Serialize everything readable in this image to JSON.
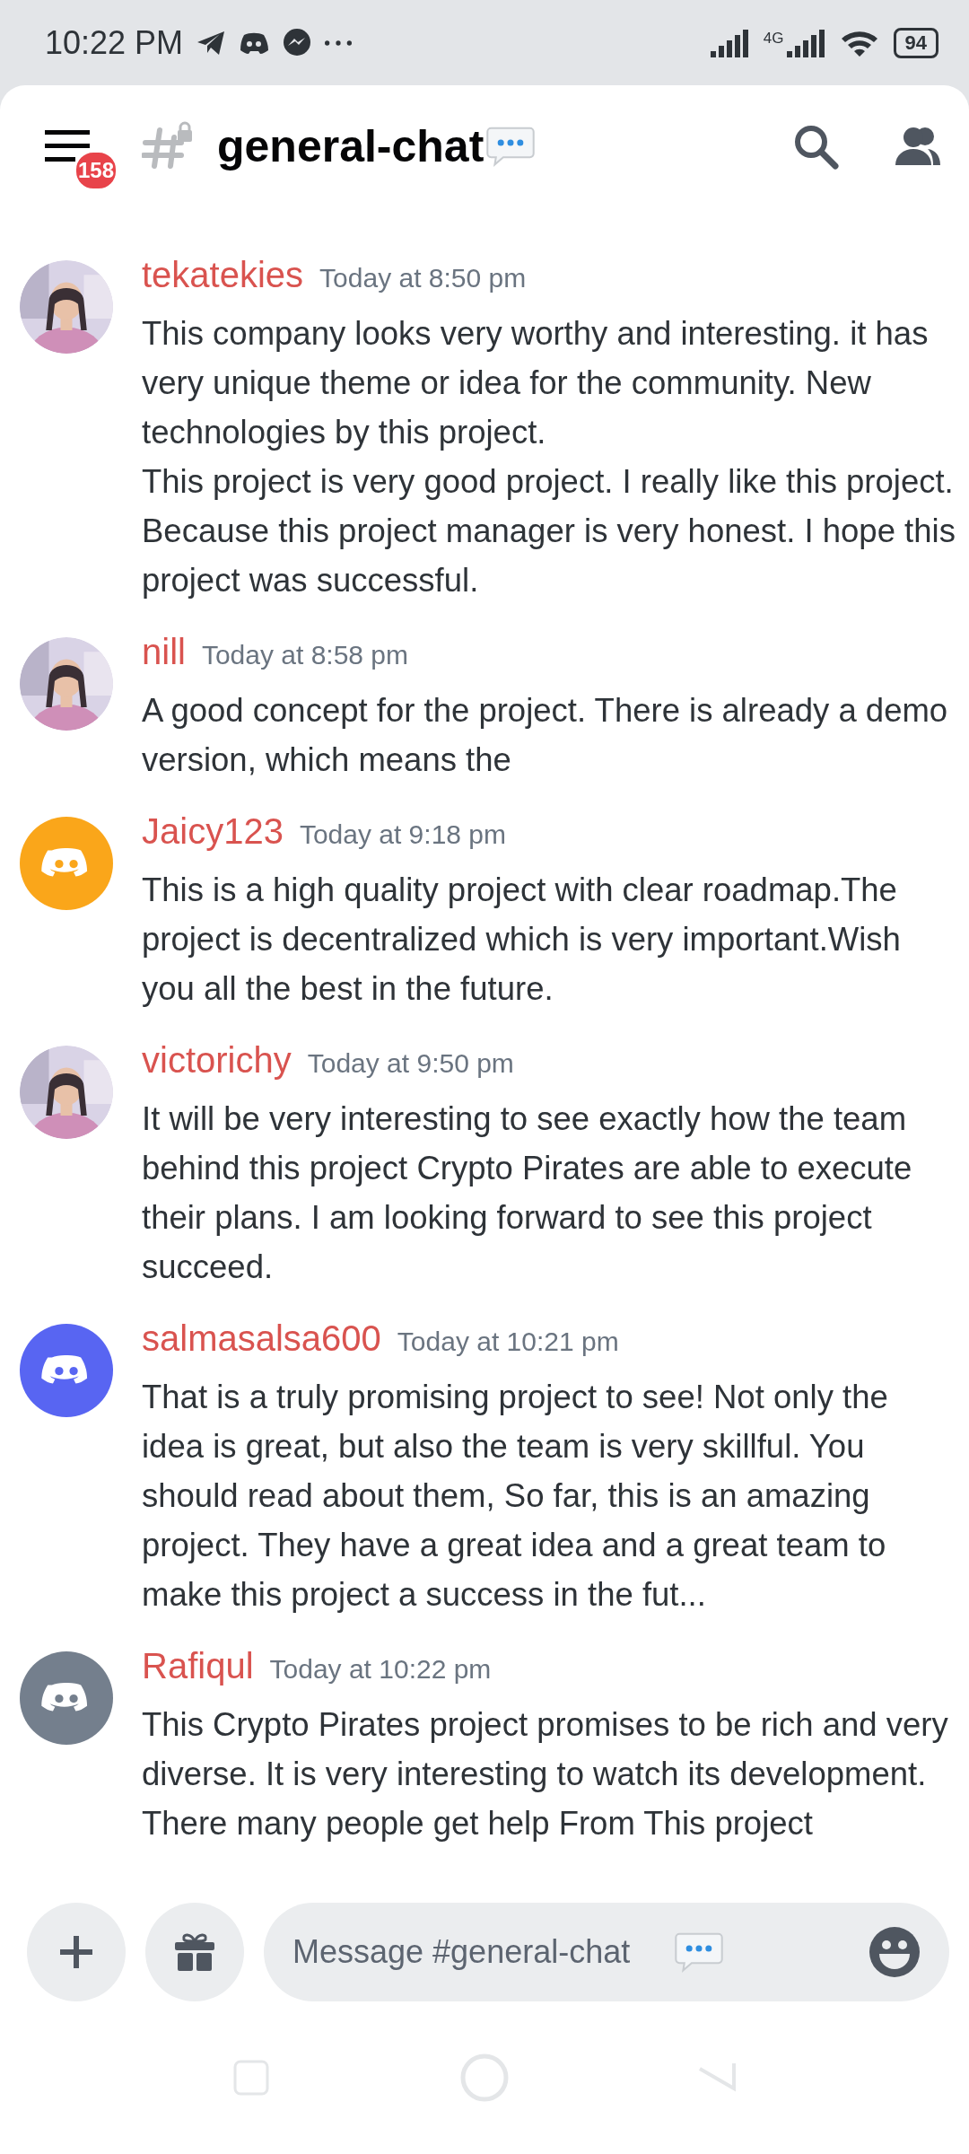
{
  "status_bar": {
    "time": "10:22 PM",
    "network": "4G",
    "battery": "94"
  },
  "header": {
    "badge": "158",
    "channel": "general-chat"
  },
  "messages": [
    {
      "author": "tekatekies",
      "time": "Today at 8:50 pm",
      "text": "This company looks very worthy and interesting. it has very unique theme or idea for the community. New technologies by this project.\nThis project is very good project. I really like this project. Because this project manager is very honest. I hope this project was successful."
    },
    {
      "author": "nill",
      "time": "Today at 8:58 pm",
      "text": "A good concept for the project. There is already a demo version, which means the"
    },
    {
      "author": "Jaicy123",
      "time": "Today at 9:18 pm",
      "text": "This is a high quality project with clear roadmap.The project is decentralized which is very important.Wish you all the best in the future.",
      "avatar": {
        "kind": "logo",
        "color": "#faa61a"
      }
    },
    {
      "author": "victorichy",
      "time": "Today at 9:50 pm",
      "text": "It will be very interesting to see exactly how the team behind this project Crypto Pirates are able to execute their plans. I am looking forward to see this project succeed."
    },
    {
      "author": "salmasalsa600",
      "time": "Today at 10:21 pm",
      "text": "That is a truly promising project to see! Not only the idea is great, but also the team is very skillful. You should read about them, So far, this is an amazing project. They have a great idea and a great team to make this project a success in the fut...",
      "avatar": {
        "kind": "logo",
        "color": "#5865f2"
      }
    },
    {
      "author": "Rafiqul",
      "time": "Today at 10:22 pm",
      "text": "This Crypto Pirates project promises to be rich and very diverse. It is very interesting to watch its development. There many people get help From This project",
      "avatar": {
        "kind": "logo",
        "color": "#747f8d"
      }
    }
  ],
  "composer": {
    "placeholder": "Message #general-chat"
  }
}
